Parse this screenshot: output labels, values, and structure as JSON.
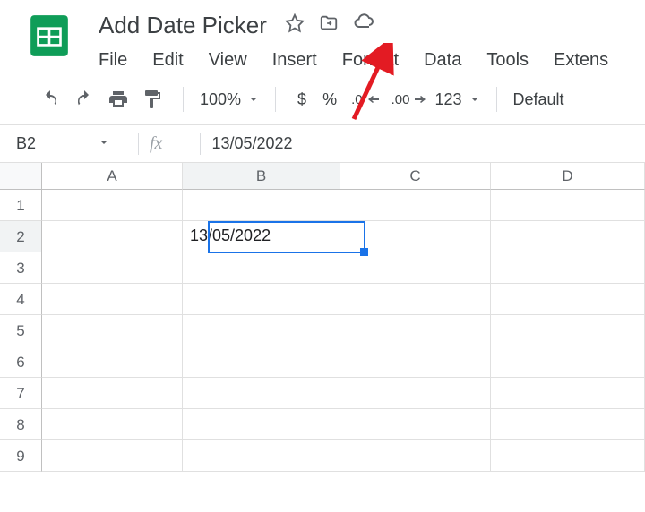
{
  "document": {
    "title": "Add Date Picker"
  },
  "menu": {
    "file": "File",
    "edit": "Edit",
    "view": "View",
    "insert": "Insert",
    "format": "Format",
    "data": "Data",
    "tools": "Tools",
    "extensions": "Extens"
  },
  "toolbar": {
    "zoom": "100%",
    "currency": "$",
    "percent": "%",
    "decrease_decimal": ".0",
    "increase_decimal": ".00",
    "num_format": "123",
    "font": "Default"
  },
  "formula_bar": {
    "cell_ref": "B2",
    "fx": "fx",
    "value": "13/05/2022"
  },
  "grid": {
    "columns": [
      "A",
      "B",
      "C",
      "D"
    ],
    "rows": [
      "1",
      "2",
      "3",
      "4",
      "5",
      "6",
      "7",
      "8",
      "9"
    ],
    "b2_value": "13/05/2022"
  }
}
